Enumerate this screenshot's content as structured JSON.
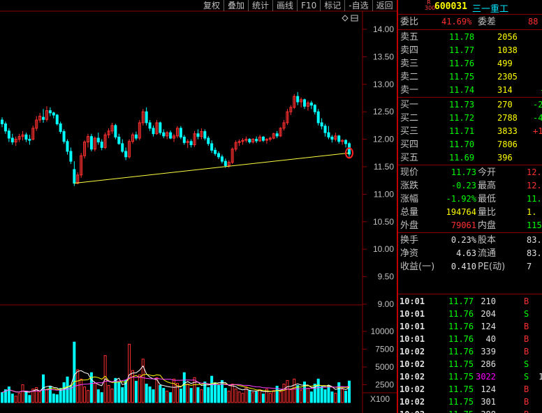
{
  "toolbar": [
    "复权",
    "叠加",
    "统计",
    "画线",
    "F10",
    "标记",
    "-自选",
    "返回"
  ],
  "colors": {
    "up": "#ff3030",
    "down": "#00ffff",
    "bg": "#000000",
    "grid": "#8b0000"
  },
  "stock": {
    "market": "R\n300",
    "code": "600031",
    "name": "三一重工"
  },
  "weibi": {
    "label1": "委比",
    "value1": "41.69%",
    "label2": "委差",
    "value2": "88"
  },
  "asks": [
    {
      "label": "卖五",
      "price": "11.78",
      "vol": "2056",
      "chg": ""
    },
    {
      "label": "卖四",
      "price": "11.77",
      "vol": "1038",
      "chg": ""
    },
    {
      "label": "卖三",
      "price": "11.76",
      "vol": "499",
      "chg": ""
    },
    {
      "label": "卖二",
      "price": "11.75",
      "vol": "2305",
      "chg": ""
    },
    {
      "label": "卖一",
      "price": "11.74",
      "vol": "314",
      "chg": "-"
    }
  ],
  "bids": [
    {
      "label": "买一",
      "price": "11.73",
      "vol": "270",
      "chg": "-2"
    },
    {
      "label": "买二",
      "price": "11.72",
      "vol": "2788",
      "chg": "-4"
    },
    {
      "label": "买三",
      "price": "11.71",
      "vol": "3833",
      "chg": "+1"
    },
    {
      "label": "买四",
      "price": "11.70",
      "vol": "7806",
      "chg": ""
    },
    {
      "label": "买五",
      "price": "11.69",
      "vol": "396",
      "chg": ""
    }
  ],
  "quote": [
    {
      "l1": "现价",
      "v1": "11.73",
      "c1": "g",
      "l2": "今开",
      "v2": "12.",
      "c2": "r"
    },
    {
      "l1": "涨跌",
      "v1": "-0.23",
      "c1": "g",
      "l2": "最高",
      "v2": "12.",
      "c2": "r"
    },
    {
      "l1": "涨幅",
      "v1": "-1.92%",
      "c1": "g",
      "l2": "最低",
      "v2": "11.",
      "c2": "g"
    },
    {
      "l1": "总量",
      "v1": "194764",
      "c1": "y",
      "l2": "量比",
      "v2": "1.",
      "c2": "y"
    },
    {
      "l1": "外盘",
      "v1": "79061",
      "c1": "r",
      "l2": "内盘",
      "v2": "1157",
      "c2": "g"
    }
  ],
  "fund": [
    {
      "l1": "换手",
      "v1": "0.23%",
      "l2": "股本",
      "v2": "83.8"
    },
    {
      "l1": "净资",
      "v1": "4.63",
      "l2": "流通",
      "v2": "83.4"
    },
    {
      "l1": "收益(一)",
      "v1": "0.410",
      "l2": "PE(动)",
      "v2": "7"
    }
  ],
  "ticks": [
    {
      "time": "10:01",
      "price": "11.77",
      "vol": "210",
      "vc": "w",
      "bs": "B",
      "x": ""
    },
    {
      "time": "10:01",
      "price": "11.76",
      "vol": "204",
      "vc": "w",
      "bs": "S",
      "x": ""
    },
    {
      "time": "10:01",
      "price": "11.76",
      "vol": "124",
      "vc": "w",
      "bs": "B",
      "x": ""
    },
    {
      "time": "10:01",
      "price": "11.76",
      "vol": "40",
      "vc": "w",
      "bs": "B",
      "x": ""
    },
    {
      "time": "10:02",
      "price": "11.76",
      "vol": "339",
      "vc": "w",
      "bs": "B",
      "x": ""
    },
    {
      "time": "10:02",
      "price": "11.75",
      "vol": "286",
      "vc": "w",
      "bs": "S",
      "x": ""
    },
    {
      "time": "10:02",
      "price": "11.75",
      "vol": "3022",
      "vc": "m",
      "bs": "S",
      "x": "1"
    },
    {
      "time": "10:02",
      "price": "11.75",
      "vol": "124",
      "vc": "w",
      "bs": "B",
      "x": ""
    },
    {
      "time": "10:02",
      "price": "11.75",
      "vol": "301",
      "vc": "w",
      "bs": "B",
      "x": ""
    },
    {
      "time": "10:02",
      "price": "11.75",
      "vol": "388",
      "vc": "w",
      "bs": "B",
      "x": ""
    },
    {
      "time": "10:02",
      "price": "11.75",
      "vol": "120",
      "vc": "w",
      "bs": "B",
      "x": ""
    }
  ],
  "chart_data": {
    "type": "candlestick",
    "price_axis": [
      "14.00",
      "13.50",
      "13.00",
      "12.50",
      "12.00",
      "11.50",
      "11.00",
      "10.50",
      "10.00",
      "9.50",
      "9.00"
    ],
    "volume_axis": [
      "10000",
      "7500",
      "5000",
      "2500"
    ],
    "volume_unit": "X100",
    "candles": [
      [
        12.35,
        12.4,
        12.22,
        12.28
      ],
      [
        12.28,
        12.32,
        12.1,
        12.15
      ],
      [
        12.15,
        12.2,
        11.95,
        12.02
      ],
      [
        12.02,
        12.1,
        11.9,
        11.95
      ],
      [
        11.95,
        12.05,
        11.88,
        12.0
      ],
      [
        12.0,
        12.1,
        11.95,
        12.05
      ],
      [
        12.05,
        12.15,
        11.98,
        12.08
      ],
      [
        12.08,
        12.12,
        11.95,
        12.0
      ],
      [
        12.0,
        12.08,
        11.9,
        11.98
      ],
      [
        12.0,
        12.25,
        11.98,
        12.2
      ],
      [
        12.2,
        12.42,
        12.15,
        12.35
      ],
      [
        12.35,
        12.48,
        12.3,
        12.42
      ],
      [
        12.4,
        12.55,
        12.3,
        12.36
      ],
      [
        12.36,
        12.6,
        12.32,
        12.52
      ],
      [
        12.52,
        12.58,
        12.42,
        12.48
      ],
      [
        12.48,
        12.5,
        12.38,
        12.44
      ],
      [
        12.44,
        12.46,
        12.25,
        12.28
      ],
      [
        12.28,
        12.32,
        12.1,
        12.14
      ],
      [
        12.14,
        12.18,
        11.92,
        11.96
      ],
      [
        11.96,
        12.0,
        11.72,
        11.78
      ],
      [
        11.78,
        11.85,
        11.55,
        11.6
      ],
      [
        11.45,
        11.6,
        11.15,
        11.2
      ],
      [
        11.2,
        11.4,
        11.18,
        11.35
      ],
      [
        11.35,
        11.75,
        11.3,
        11.7
      ],
      [
        11.7,
        11.98,
        11.65,
        11.95
      ],
      [
        11.95,
        12.1,
        11.85,
        12.05
      ],
      [
        12.05,
        12.1,
        11.78,
        11.82
      ],
      [
        11.82,
        12.05,
        11.78,
        12.02
      ],
      [
        12.02,
        12.12,
        11.9,
        11.95
      ],
      [
        11.95,
        12.0,
        11.8,
        11.85
      ],
      [
        11.85,
        12.12,
        11.82,
        12.08
      ],
      [
        12.08,
        12.2,
        12.02,
        12.15
      ],
      [
        12.15,
        12.3,
        12.1,
        12.25
      ],
      [
        12.25,
        12.28,
        12.0,
        12.04
      ],
      [
        12.04,
        12.1,
        11.9,
        11.92
      ],
      [
        11.92,
        12.0,
        11.75,
        11.78
      ],
      [
        11.78,
        11.85,
        11.62,
        11.68
      ],
      [
        11.68,
        12.0,
        11.65,
        11.96
      ],
      [
        11.96,
        12.12,
        11.92,
        12.08
      ],
      [
        12.08,
        12.14,
        11.98,
        12.02
      ],
      [
        12.02,
        12.35,
        11.98,
        12.3
      ],
      [
        12.3,
        12.55,
        12.25,
        12.5
      ],
      [
        12.5,
        12.58,
        12.25,
        12.3
      ],
      [
        12.3,
        12.35,
        12.15,
        12.2
      ],
      [
        12.2,
        12.25,
        12.05,
        12.1
      ],
      [
        12.1,
        12.35,
        12.08,
        12.3
      ],
      [
        12.3,
        12.32,
        12.08,
        12.12
      ],
      [
        12.12,
        12.18,
        12.02,
        12.06
      ],
      [
        12.06,
        12.15,
        12.0,
        12.12
      ],
      [
        12.12,
        12.16,
        12.0,
        12.02
      ],
      [
        12.02,
        12.1,
        11.95,
        12.06
      ],
      [
        12.06,
        12.24,
        12.02,
        12.2
      ],
      [
        12.2,
        12.24,
        12.0,
        12.04
      ],
      [
        12.04,
        12.08,
        11.9,
        11.94
      ],
      [
        11.94,
        12.0,
        11.84,
        11.96
      ],
      [
        11.96,
        12.0,
        11.85,
        11.9
      ],
      [
        11.9,
        12.15,
        11.86,
        12.1
      ],
      [
        12.1,
        12.18,
        12.0,
        12.05
      ],
      [
        12.05,
        12.2,
        12.0,
        12.14
      ],
      [
        12.14,
        12.18,
        11.98,
        12.02
      ],
      [
        12.02,
        12.06,
        11.88,
        11.92
      ],
      [
        11.92,
        11.98,
        11.75,
        11.8
      ],
      [
        11.8,
        11.85,
        11.7,
        11.74
      ],
      [
        11.74,
        11.78,
        11.64,
        11.68
      ],
      [
        11.68,
        11.72,
        11.56,
        11.6
      ],
      [
        11.6,
        11.65,
        11.48,
        11.52
      ],
      [
        11.52,
        11.62,
        11.48,
        11.58
      ],
      [
        11.58,
        11.85,
        11.55,
        11.82
      ],
      [
        11.82,
        11.98,
        11.78,
        11.94
      ],
      [
        11.94,
        12.0,
        11.88,
        11.96
      ],
      [
        11.96,
        12.02,
        11.9,
        11.98
      ],
      [
        11.98,
        12.05,
        11.94,
        12.0
      ],
      [
        12.0,
        12.02,
        11.92,
        11.95
      ],
      [
        11.95,
        12.02,
        11.92,
        12.0
      ],
      [
        12.0,
        12.05,
        11.93,
        11.97
      ],
      [
        11.97,
        12.08,
        11.95,
        12.04
      ],
      [
        12.04,
        12.06,
        11.95,
        11.98
      ],
      [
        11.98,
        12.02,
        11.92,
        12.0
      ],
      [
        12.0,
        12.05,
        11.96,
        12.02
      ],
      [
        12.02,
        12.12,
        12.0,
        12.1
      ],
      [
        12.1,
        12.15,
        12.02,
        12.06
      ],
      [
        12.06,
        12.22,
        12.04,
        12.2
      ],
      [
        12.2,
        12.35,
        12.16,
        12.3
      ],
      [
        12.3,
        12.55,
        12.26,
        12.5
      ],
      [
        12.5,
        12.62,
        12.44,
        12.58
      ],
      [
        12.58,
        12.82,
        12.55,
        12.78
      ],
      [
        12.78,
        12.86,
        12.62,
        12.68
      ],
      [
        12.68,
        12.76,
        12.58,
        12.72
      ],
      [
        12.72,
        12.74,
        12.55,
        12.6
      ],
      [
        12.6,
        12.7,
        12.52,
        12.66
      ],
      [
        12.66,
        12.7,
        12.55,
        12.62
      ],
      [
        12.62,
        12.64,
        12.45,
        12.5
      ],
      [
        12.5,
        12.55,
        12.25,
        12.3
      ],
      [
        12.3,
        12.38,
        12.18,
        12.24
      ],
      [
        12.24,
        12.28,
        12.05,
        12.12
      ],
      [
        12.12,
        12.24,
        12.0,
        12.04
      ],
      [
        12.04,
        12.08,
        11.94,
        12.0
      ],
      [
        12.0,
        12.12,
        11.96,
        12.06
      ],
      [
        12.06,
        12.08,
        11.92,
        11.96
      ],
      [
        11.96,
        12.0,
        11.9,
        11.98
      ],
      [
        11.98,
        12.0,
        11.85,
        11.92
      ],
      [
        11.92,
        11.95,
        11.68,
        11.73
      ]
    ],
    "trendline": {
      "from_index": 21,
      "from_price": 11.2,
      "to_index": 101,
      "to_price": 11.75
    },
    "volumes": [
      1400,
      1800,
      2200,
      1200,
      900,
      1300,
      2500,
      1600,
      1000,
      1900,
      2100,
      1500,
      3900,
      1800,
      2300,
      1200,
      1100,
      2000,
      2800,
      3600,
      2400,
      8500,
      4600,
      3300,
      2200,
      1700,
      4200,
      2700,
      1800,
      1400,
      6600,
      2400,
      1900,
      3400,
      2800,
      2100,
      3100,
      8200,
      4500,
      3000,
      3900,
      6100,
      2600,
      2200,
      1800,
      3500,
      2400,
      2000,
      1600,
      1400,
      3300,
      2700,
      1900,
      4200,
      2600,
      2000,
      3500,
      2100,
      1800,
      2900,
      2100,
      3700,
      2800,
      2400,
      3100,
      2000,
      1600,
      2600,
      1900,
      1500,
      1300,
      2200,
      1700,
      1400,
      1500,
      1800,
      1200,
      1900,
      1300,
      1700,
      2300,
      1500,
      2600,
      3100,
      1800,
      3300,
      2400,
      1700,
      2900,
      2000,
      1500,
      2600,
      3300,
      2200,
      1800,
      2400,
      1500,
      1300,
      2800,
      1900,
      1600,
      3022
    ]
  }
}
